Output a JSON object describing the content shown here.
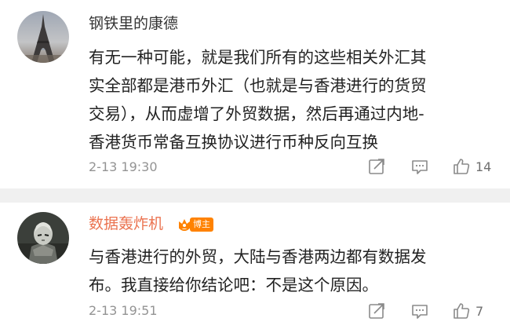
{
  "comments": [
    {
      "username": "钢铁里的康德",
      "body_lines": [
        "有无一种可能，就是我们所有的这些相关外汇其",
        "实全部都是港币外汇（也就是与香港进行的货贸",
        "交易），从而虚增了外贸数据，然后再通过内地-",
        "香港货币常备互换协议进行币种反向互换"
      ],
      "timestamp": "2-13 19:30",
      "like_count": "14",
      "avatar_icon": "eiffel-tower-avatar"
    },
    {
      "username": "数据轰炸机",
      "badge": "博主",
      "body_lines": [
        "与香港进行的外贸，大陆与香港两边都有数据发",
        "布。我直接给你结论吧：不是这个原因。"
      ],
      "timestamp": "2-13 19:51",
      "like_count": "7",
      "avatar_icon": "armored-character-avatar"
    }
  ],
  "icons": {
    "share": "share-icon",
    "comment": "comment-icon",
    "like": "thumbs-up-icon"
  },
  "colors": {
    "author_name": "#eb7350",
    "badge_bg": "#ff8200",
    "divider": "#f0f0f0",
    "timestamp": "#939393"
  }
}
